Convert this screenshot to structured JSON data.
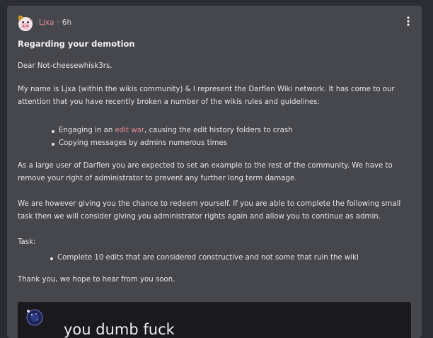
{
  "post": {
    "author": "Ljxa",
    "separator": "·",
    "age": "6h",
    "title": "Regarding your demotion",
    "greeting": "Dear Not-cheesewhisk3rs,",
    "intro": "My name is Ljxa (within the wikis community) & I represent the Darflen Wiki network. It has come to our attention that you have recently broken a number of the wikis rules and guidelines:",
    "violations": {
      "item1_prefix": "Engaging in an ",
      "item1_link": "edit war",
      "item1_suffix": ", causing the edit history folders to crash",
      "item2": "Copying messages by admins numerous times"
    },
    "damage": "As a large user of Darflen you are expected to set an example to the rest of the community. We have to remove your right of administrator to prevent any further long term damage.",
    "redeem": "We are however giving you the chance to redeem yourself. If you are able to complete the following small task then we will  consider giving you administrator rights again and allow you to continue as admin.",
    "task_label": "Task:",
    "task_item": "Complete 10 edits that are considered constructive and not some that ruin the wiki",
    "thanks": "Thank you, we hope to hear from you soon."
  },
  "embed": {
    "text": "you dumb fuck"
  },
  "icons": {
    "avatar": "cow-avatar-with-sunflower",
    "menu": "kebab-menu-icon",
    "embed_avatar": "space-avatar"
  },
  "colors": {
    "background": "#2c2c33",
    "card": "#46464d",
    "accent": "#e48b95",
    "embed_bg": "#1a1a1e"
  }
}
